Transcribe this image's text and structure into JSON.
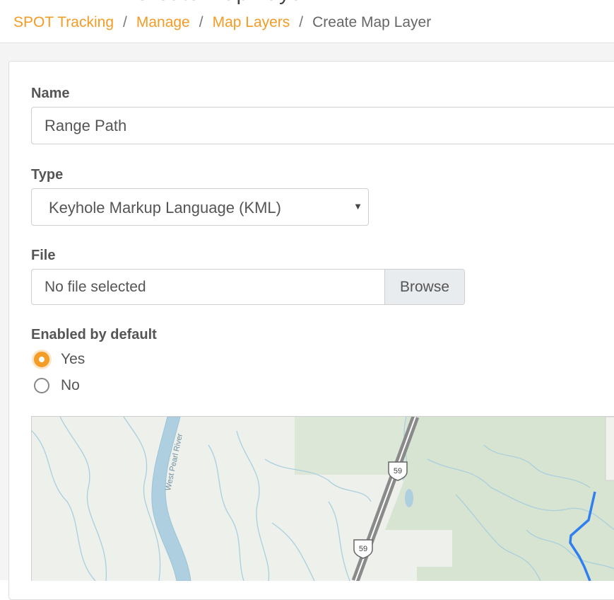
{
  "header": {
    "title_cut": "Create Map Layer",
    "breadcrumb": {
      "items": [
        "SPOT Tracking",
        "Manage",
        "Map Layers"
      ],
      "separator": "/",
      "current": "Create Map Layer"
    }
  },
  "form": {
    "name": {
      "label": "Name",
      "value": "Range Path"
    },
    "type": {
      "label": "Type",
      "selected": "Keyhole Markup Language (KML)"
    },
    "file": {
      "label": "File",
      "placeholder": "No file selected",
      "browse_label": "Browse"
    },
    "enabled": {
      "label": "Enabled by default",
      "options": [
        {
          "label": "Yes",
          "checked": true
        },
        {
          "label": "No",
          "checked": false
        }
      ]
    }
  },
  "map": {
    "river_label": "West Pearl River",
    "highway_shield": "59"
  },
  "colors": {
    "accent": "#f39c26",
    "track_line": "#2f7fef"
  }
}
